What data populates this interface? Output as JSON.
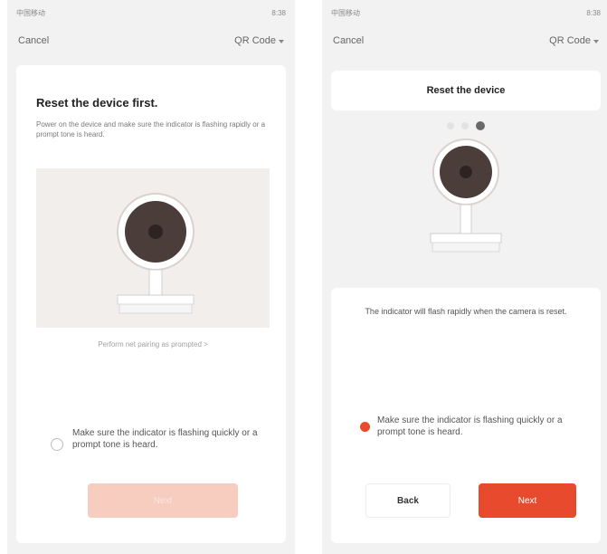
{
  "left": {
    "status": {
      "left": "中国移动",
      "right": "8:38"
    },
    "nav": {
      "cancel": "Cancel",
      "mode": "QR Code"
    },
    "title": "Reset the device first.",
    "description": "Power on the device and make sure the indicator is flashing rapidly or a prompt tone is heard.",
    "hint": "Perform net pairing as prompted >",
    "check_label": "Make sure the indicator is flashing quickly or a prompt tone is heard.",
    "next_label": "Next"
  },
  "right": {
    "status": {
      "left": "中国移动",
      "right": "8:38"
    },
    "nav": {
      "cancel": "Cancel",
      "mode": "QR Code"
    },
    "header": "Reset the device",
    "info": "The indicator will flash rapidly when the camera is reset.",
    "check_label": "Make sure the indicator is flashing quickly or a prompt tone is heard.",
    "back_label": "Back",
    "next_label": "Next",
    "step_dots": 3,
    "active_dot": 3
  },
  "colors": {
    "accent": "#e84a2e",
    "accent_disabled": "#f6cdbf",
    "background": "#f2f2f2"
  },
  "icons": {
    "chevron": "chevron-down-icon",
    "camera": "camera-illustration"
  }
}
